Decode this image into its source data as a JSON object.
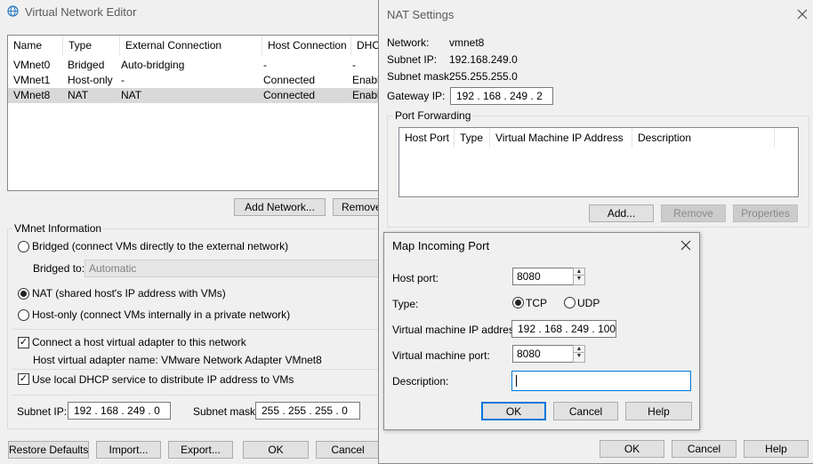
{
  "vne": {
    "title": "Virtual Network Editor",
    "columns": [
      "Name",
      "Type",
      "External Connection",
      "Host Connection",
      "DHCP"
    ],
    "rows": [
      {
        "name": "VMnet0",
        "type": "Bridged",
        "external": "Auto-bridging",
        "host": "-",
        "dhcp": "-"
      },
      {
        "name": "VMnet1",
        "type": "Host-only",
        "external": "-",
        "host": "Connected",
        "dhcp": "Enable"
      },
      {
        "name": "VMnet8",
        "type": "NAT",
        "external": "NAT",
        "host": "Connected",
        "dhcp": "Enable"
      }
    ],
    "add_network": "Add Network...",
    "remove": "Remove",
    "vmnet_info": "VMnet Information",
    "bridged_radio": "Bridged (connect VMs directly to the external network)",
    "bridged_to_label": "Bridged to:",
    "bridged_to_value": "Automatic",
    "nat_radio": "NAT (shared host's IP address with VMs)",
    "hostonly_radio": "Host-only (connect VMs internally in a private network)",
    "connect_adapter": "Connect a host virtual adapter to this network",
    "adapter_name": "Host virtual adapter name: VMware Network Adapter VMnet8",
    "use_dhcp": "Use local DHCP service to distribute IP address to VMs",
    "subnet_ip_label": "Subnet IP:",
    "subnet_ip": "192 . 168 . 249 .  0",
    "subnet_mask_label": "Subnet mask:",
    "subnet_mask": "255 . 255 . 255 .  0",
    "restore_defaults": "Restore Defaults",
    "import": "Import...",
    "export": "Export...",
    "ok": "OK",
    "cancel": "Cancel"
  },
  "nat": {
    "title": "NAT Settings",
    "network_label": "Network:",
    "network": "vmnet8",
    "subnet_ip_label": "Subnet IP:",
    "subnet_ip": "192.168.249.0",
    "subnet_mask_label": "Subnet mask:",
    "subnet_mask": "255.255.255.0",
    "gateway_label": "Gateway IP:",
    "gateway": "192 . 168 . 249 .  2",
    "port_forwarding": "Port Forwarding",
    "pf_columns": [
      "Host Port",
      "Type",
      "Virtual Machine IP Address",
      "Description"
    ],
    "add": "Add...",
    "remove": "Remove",
    "properties": "Properties",
    "ok": "OK",
    "cancel": "Cancel",
    "help": "Help"
  },
  "map": {
    "title": "Map Incoming Port",
    "host_port_label": "Host port:",
    "host_port": "8080",
    "type_label": "Type:",
    "tcp": "TCP",
    "udp": "UDP",
    "vm_ip_label": "Virtual machine IP address:",
    "vm_ip": "192 . 168 . 249 . 100",
    "vm_port_label": "Virtual machine port:",
    "vm_port": "8080",
    "description_label": "Description:",
    "description": "",
    "ok": "OK",
    "cancel": "Cancel",
    "help": "Help"
  },
  "colors": {
    "accent": "#0078d7",
    "selection": "#d9d9d9"
  }
}
